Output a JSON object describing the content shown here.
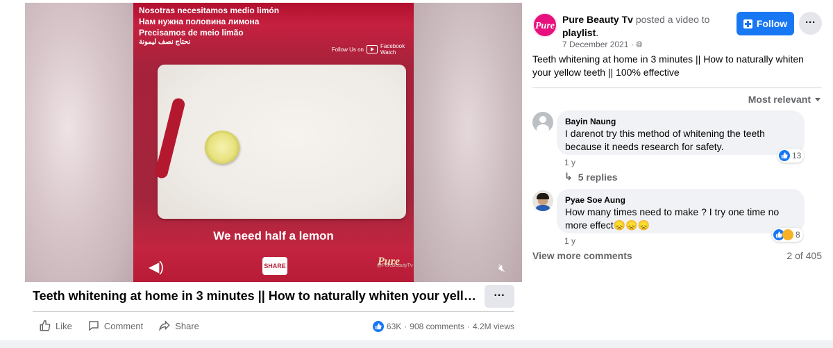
{
  "video": {
    "subtitles": [
      "Nosotras necesitamos medio limón",
      "Нам нужна половина лимона",
      "Precisamos de meio limão",
      "نحتاج نصف ليمونة"
    ],
    "follow_label": "Follow Us on",
    "fbwatch_label": "Facebook Watch",
    "watermark": "@PureBeautyTv",
    "caption": "We need half a lemon",
    "share_logo": "SHARE",
    "brand_logo": "Pure"
  },
  "title": "Teeth whitening at home in 3 minutes || How to naturally whiten your yellow teeth || 100% effective",
  "more_label": "···",
  "actions": {
    "like": "Like",
    "comment": "Comment",
    "share": "Share"
  },
  "stats": {
    "reactions": "63K",
    "comments": "908 comments",
    "views": "4.2M views",
    "sep": "·"
  },
  "post": {
    "page_logo": "Pure",
    "page_name": "Pure Beauty Tv",
    "posted_text": " posted a video to ",
    "playlist": "playlist",
    "period": ".",
    "date": "7 December 2021 · ",
    "follow_label": "Follow",
    "options_label": "···",
    "description": "Teeth whitening at home in 3 minutes || How to naturally whiten your yellow teeth || 100% effective"
  },
  "sort_label": "Most relevant",
  "comments": [
    {
      "name": "Bayin Naung",
      "text": "I darenot try this method of whitening the teeth because it needs research for safety.",
      "reactions": "13",
      "age": "1 y",
      "replies": "5 replies"
    },
    {
      "name": "Pyae Soe Aung",
      "text": "How many times need to make ? I try one time no more effect😞😞😞",
      "reactions": "8",
      "age": "1 y"
    }
  ],
  "view_more": "View more comments",
  "comment_count": "2 of 405",
  "colors": {
    "accent": "#1877f2",
    "video_red": "#b3203a",
    "page_pink": "#e8107d"
  }
}
